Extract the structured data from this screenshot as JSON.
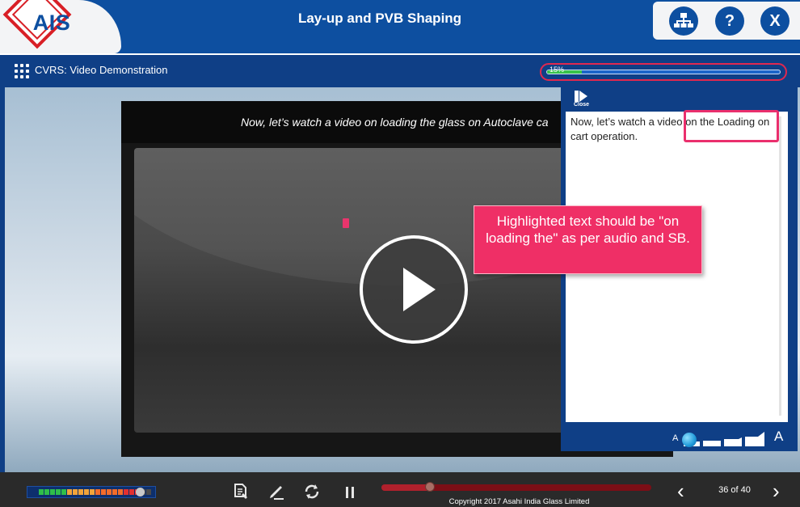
{
  "header": {
    "logo_text": "AIS",
    "course_title": "Lay-up and PVB Shaping",
    "sitemap_icon": "sitemap-icon",
    "help_label": "?",
    "exit_label": "X"
  },
  "subheader": {
    "section_title": "CVRS: Video Demonstration",
    "progress_label": "15%",
    "progress_percent": 15
  },
  "video": {
    "caption": "Now, let’s watch a video on loading the glass on Autoclave ca",
    "play_icon": "play-icon"
  },
  "transcript": {
    "close_label": "Close",
    "text": "Now, let’s watch a video on the Loading on cart operation.",
    "font_small_label": "A",
    "font_large_label": "A",
    "font_size_level": 0
  },
  "annotation": {
    "note": "Highlighted text should be \"on loading the\" as per audio and SB."
  },
  "footer": {
    "volume_level": 0.92,
    "seek_progress": 0.18,
    "notes_icon": "notes-icon",
    "pen_icon": "pen-icon",
    "replay_icon": "replay-icon",
    "pause_icon": "pause-icon",
    "copyright": "Copyright 2017 Asahi India Glass Limited",
    "page_counter": "36 of 40",
    "prev_label": "‹",
    "next_label": "›"
  }
}
